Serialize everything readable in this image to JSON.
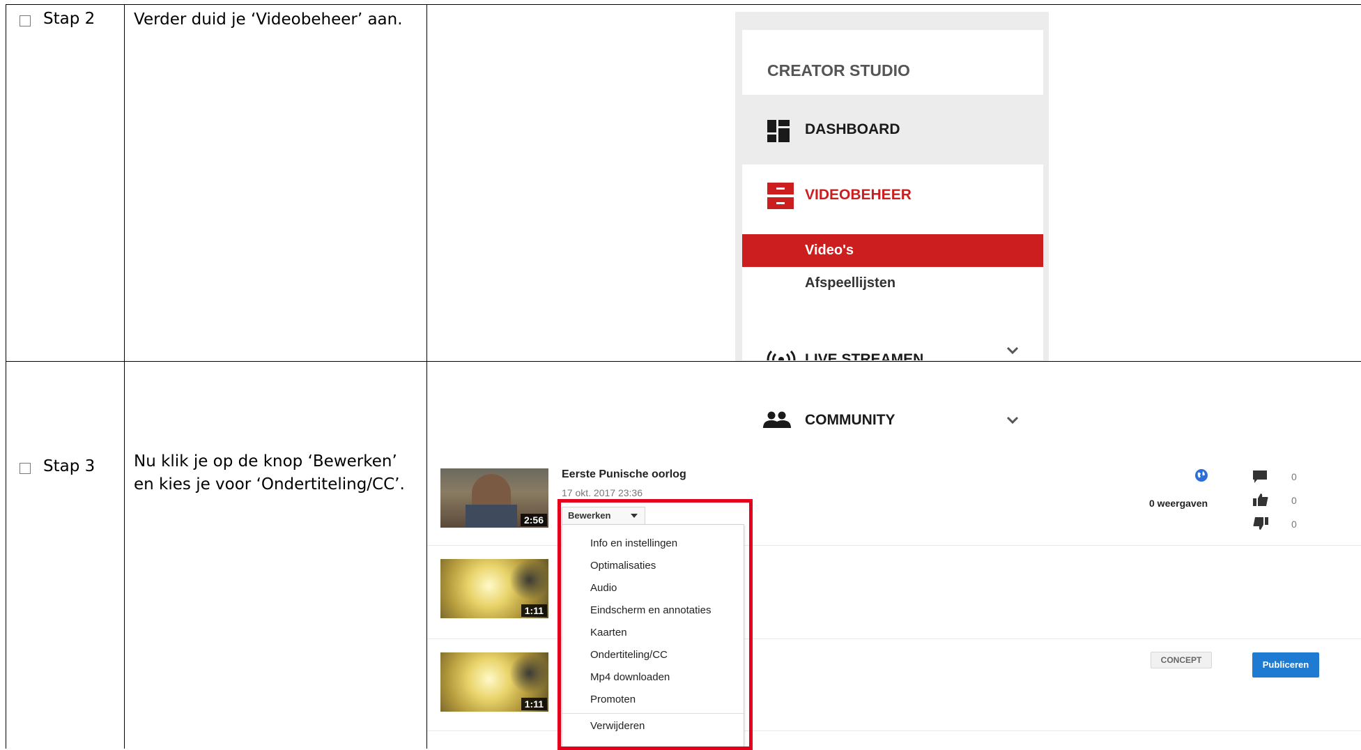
{
  "rows": [
    {
      "checkbox": "☐",
      "step": "Stap 2",
      "instruction": [
        "Verder duid je ‘Videobeheer’ aan."
      ]
    },
    {
      "checkbox": "☐",
      "step": "Stap 3",
      "instruction": [
        "Nu klik je op de knop ‘Bewerken’",
        "en kies je voor ‘Ondertiteling/CC’."
      ]
    }
  ],
  "studio": {
    "title": "CREATOR STUDIO",
    "dashboard": "DASHBOARD",
    "videobeheer": "VIDEOBEHEER",
    "videos": "Video's",
    "playlists": "Afspeellijsten",
    "live": "LIVE STREAMEN",
    "community": "COMMUNITY",
    "accent": "#CC1E1E"
  },
  "video_list": {
    "video1": {
      "title": "Eerste Punische oorlog",
      "date": "17 okt. 2017 23:36",
      "duration": "2:56",
      "views": "0 weergaven",
      "comments": "0",
      "likes": "0",
      "dislikes": "0"
    },
    "video2": {
      "duration": "1:11"
    },
    "video3": {
      "duration": "1:11",
      "status": "CONCEPT",
      "publish": "Publiceren"
    },
    "edit_button": "Bewerken",
    "menu": [
      "Info en instellingen",
      "Optimalisaties",
      "Audio",
      "Eindscherm en annotaties",
      "Kaarten",
      "Ondertiteling/CC",
      "Mp4 downloaden",
      "Promoten",
      "Verwijderen"
    ]
  }
}
